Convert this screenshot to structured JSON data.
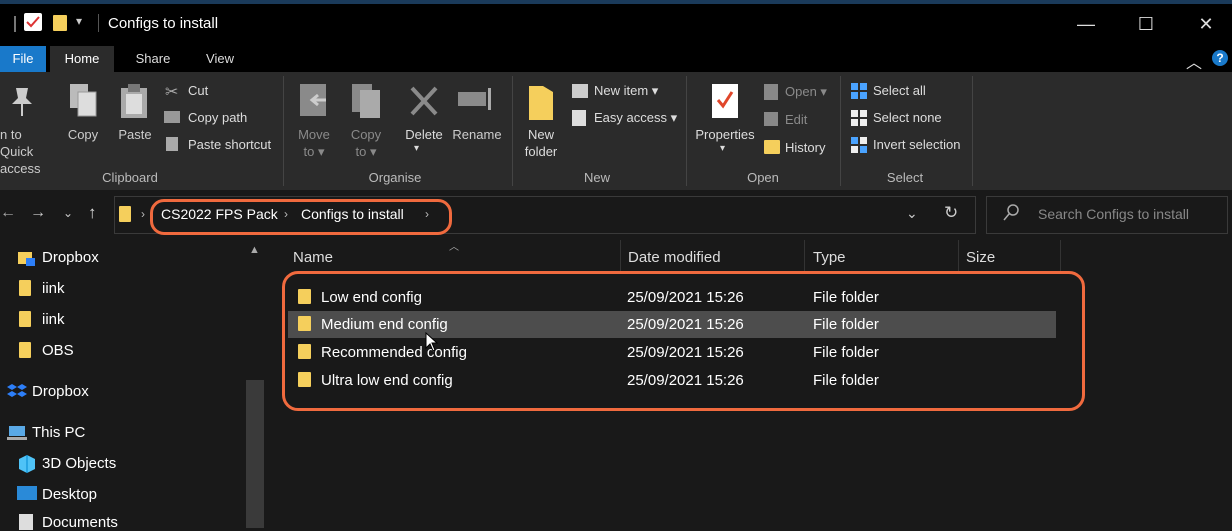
{
  "window": {
    "title": "Configs to install",
    "controls": {
      "minimize": "—",
      "maximize": "☐",
      "close": "✕"
    }
  },
  "tabs": [
    {
      "label": "File"
    },
    {
      "label": "Home"
    },
    {
      "label": "Share"
    },
    {
      "label": "View"
    }
  ],
  "ribbon": {
    "clipboard": {
      "label": "Clipboard",
      "pin_l1": "n to Quick",
      "pin_l2": "access",
      "copy": "Copy",
      "paste": "Paste",
      "cut": "Cut",
      "copy_path": "Copy path",
      "paste_shortcut": "Paste shortcut"
    },
    "organise": {
      "label": "Organise",
      "move_l1": "Move",
      "move_l2": "to",
      "copy_l1": "Copy",
      "copy_l2": "to",
      "delete": "Delete",
      "rename": "Rename"
    },
    "new": {
      "label": "New",
      "new_folder_l1": "New",
      "new_folder_l2": "folder",
      "new_item": "New item",
      "easy_access": "Easy access"
    },
    "open": {
      "label": "Open",
      "properties": "Properties",
      "open": "Open",
      "edit": "Edit",
      "history": "History"
    },
    "select": {
      "label": "Select",
      "select_all": "Select all",
      "select_none": "Select none",
      "invert": "Invert selection"
    }
  },
  "address": {
    "crumbs": [
      "CS2022 FPS Pack",
      "Configs to install"
    ],
    "search_placeholder": "Search Configs to install"
  },
  "nav": {
    "items": [
      {
        "label": "Dropbox",
        "icon": "dropbox-icon"
      },
      {
        "label": "iink",
        "icon": "folder-icon"
      },
      {
        "label": "iink",
        "icon": "folder-icon"
      },
      {
        "label": "OBS",
        "icon": "folder-icon"
      },
      {
        "label": "Dropbox",
        "icon": "dropbox-icon"
      },
      {
        "label": "This PC",
        "icon": "pc-icon"
      },
      {
        "label": "3D Objects",
        "icon": "cube-icon"
      },
      {
        "label": "Desktop",
        "icon": "desktop-icon"
      },
      {
        "label": "Documents",
        "icon": "documents-icon"
      }
    ]
  },
  "columns": {
    "name": "Name",
    "date": "Date modified",
    "type": "Type",
    "size": "Size"
  },
  "files": [
    {
      "name": "Low end config",
      "date": "25/09/2021 15:26",
      "type": "File folder"
    },
    {
      "name": "Medium end config",
      "date": "25/09/2021 15:26",
      "type": "File folder"
    },
    {
      "name": "Recommended config",
      "date": "25/09/2021 15:26",
      "type": "File folder"
    },
    {
      "name": "Ultra low end config",
      "date": "25/09/2021 15:26",
      "type": "File folder"
    }
  ],
  "colors": {
    "accent": "#1979ca",
    "highlight": "#f06a3e",
    "folder": "#f5cf5c"
  }
}
